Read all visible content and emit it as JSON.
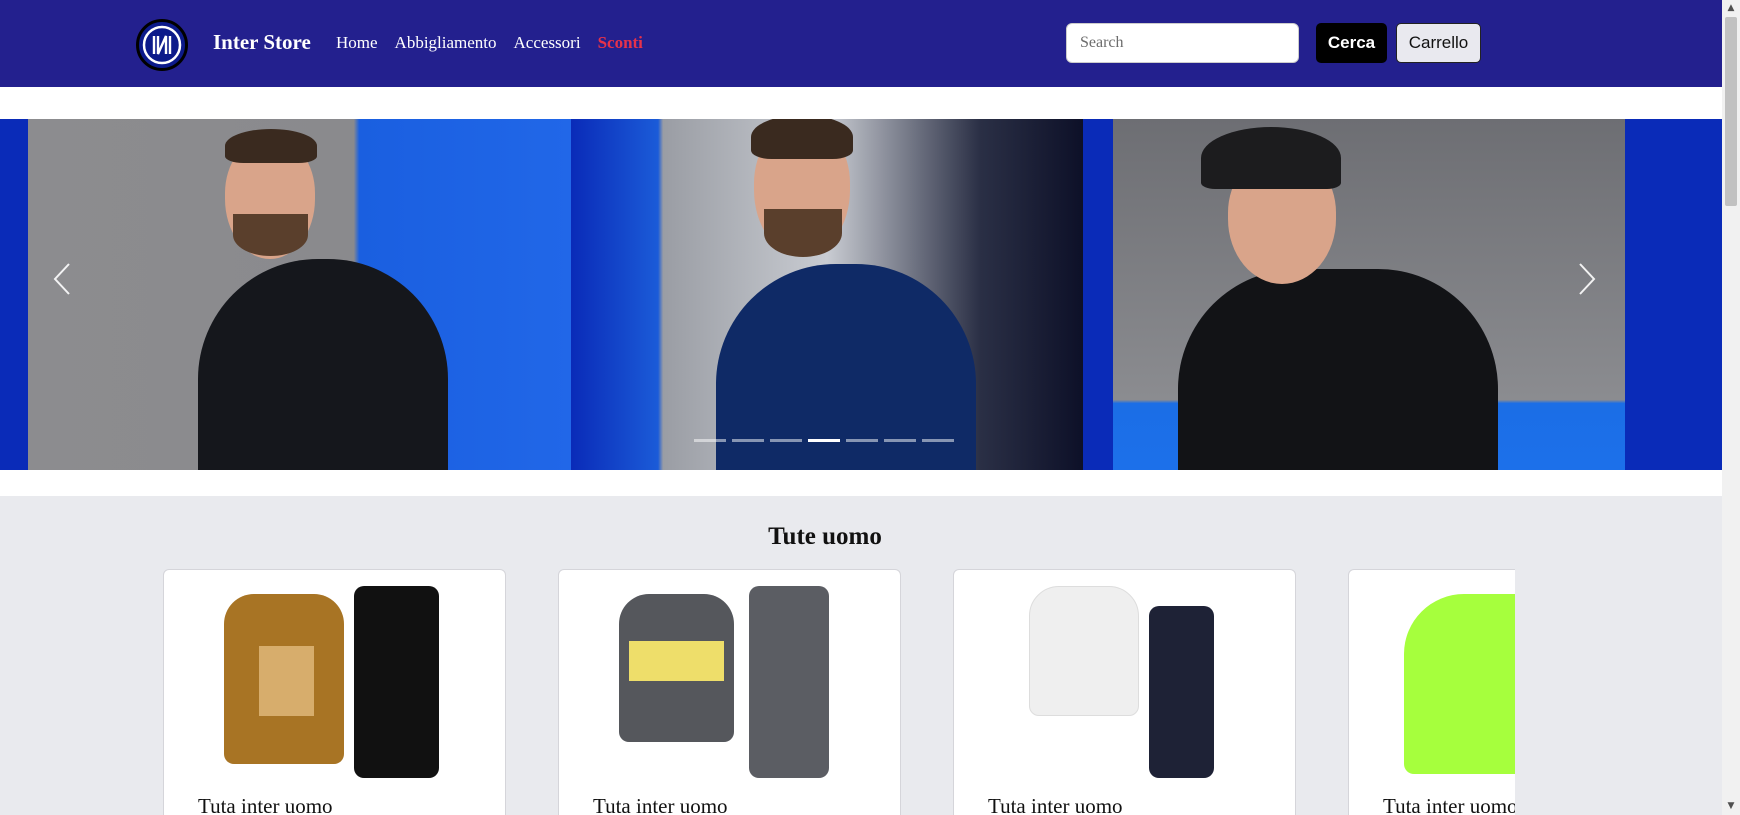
{
  "header": {
    "brand": "Inter Store",
    "nav": [
      {
        "label": "Home"
      },
      {
        "label": "Abbigliamento"
      },
      {
        "label": "Accessori"
      },
      {
        "label": "Sconti"
      }
    ],
    "search_placeholder": "Search",
    "search_button": "Cerca",
    "cart_button": "Carrello"
  },
  "carousel": {
    "prev_icon": "chevron-left-icon",
    "next_icon": "chevron-right-icon",
    "indicator_count": 7,
    "active_indicator": 4
  },
  "section": {
    "title": "Tute uomo",
    "products": [
      {
        "name": "Tuta inter uomo"
      },
      {
        "name": "Tuta inter uomo"
      },
      {
        "name": "Tuta inter uomo"
      },
      {
        "name": "Tuta inter uomo"
      }
    ]
  },
  "colors": {
    "navbar": "#23208e",
    "sale": "#e6324b",
    "section_bg": "#e9eaee"
  }
}
